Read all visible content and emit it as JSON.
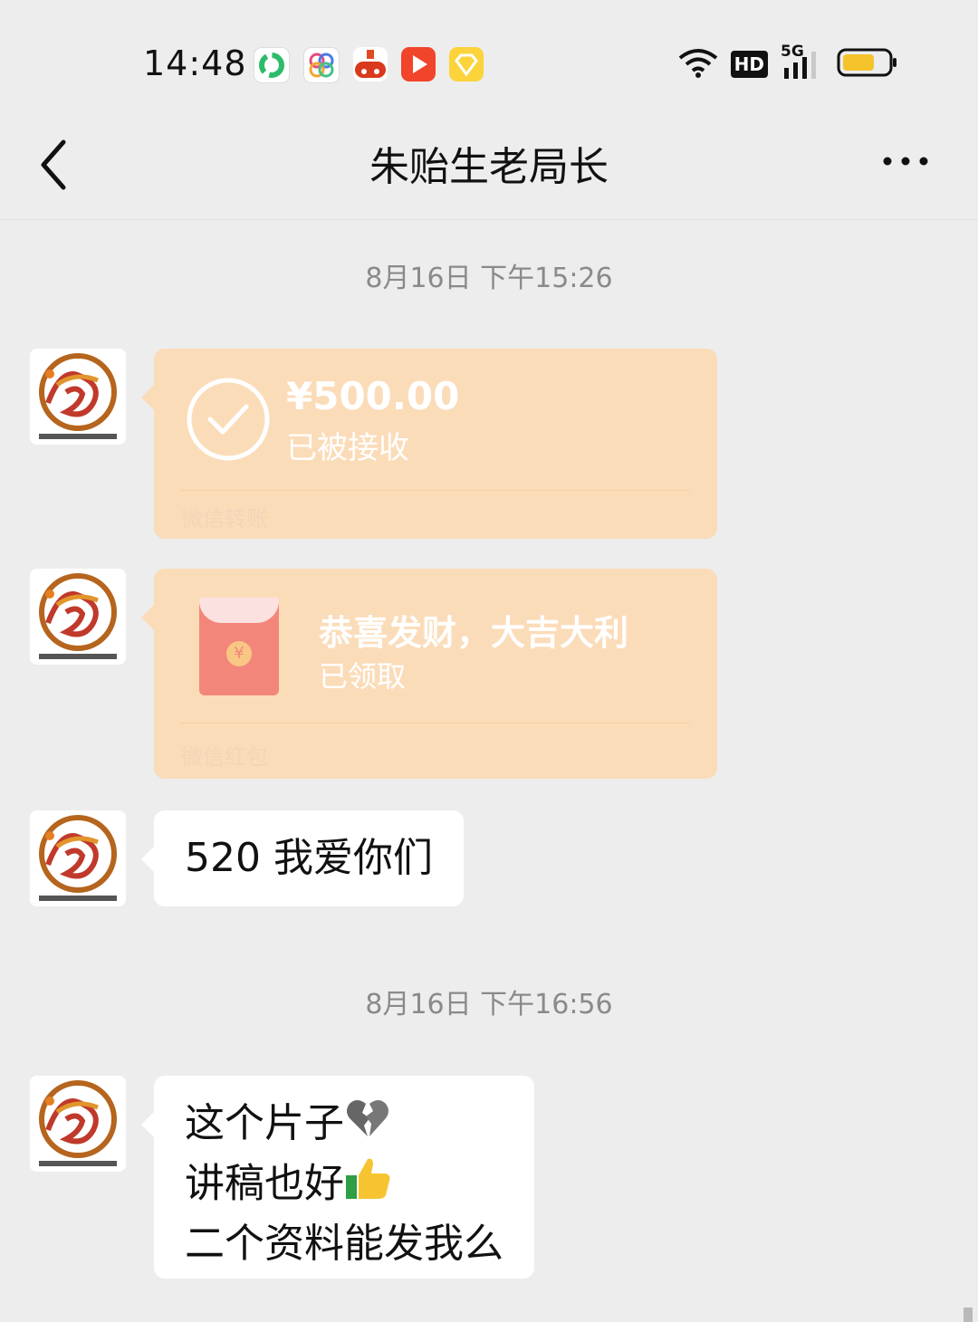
{
  "status_bar": {
    "time": "14:48",
    "app_icons": [
      "green-circle-app-icon",
      "colorful-app-icon",
      "red-car-app-icon",
      "red-play-app-icon",
      "yellow-diamond-app-icon"
    ],
    "hd_label": "HD",
    "network_label": "5G",
    "battery_color": "#f5c32c"
  },
  "header": {
    "title": "朱贻生老局长",
    "back_icon": "chevron-left-icon",
    "more_icon": "more-dots-icon"
  },
  "chat": {
    "timestamp_1": "8月16日 下午15:26",
    "transfer": {
      "amount": "¥500.00",
      "status": "已被接收",
      "footer": "微信转账"
    },
    "red_packet": {
      "title": "恭喜发财，大吉大利",
      "status": "已领取",
      "footer": "微信红包",
      "symbol": "¥"
    },
    "message_1": "520 我爱你们",
    "timestamp_2": "8月16日 下午16:56",
    "message_2": {
      "line1": "这个片子",
      "line2": "讲稿也好",
      "line3": "二个资料能发我么"
    }
  },
  "colors": {
    "background": "#ededed",
    "card": "#fbdcb9",
    "bubble": "#ffffff",
    "timestamp": "#8a8a8a"
  }
}
